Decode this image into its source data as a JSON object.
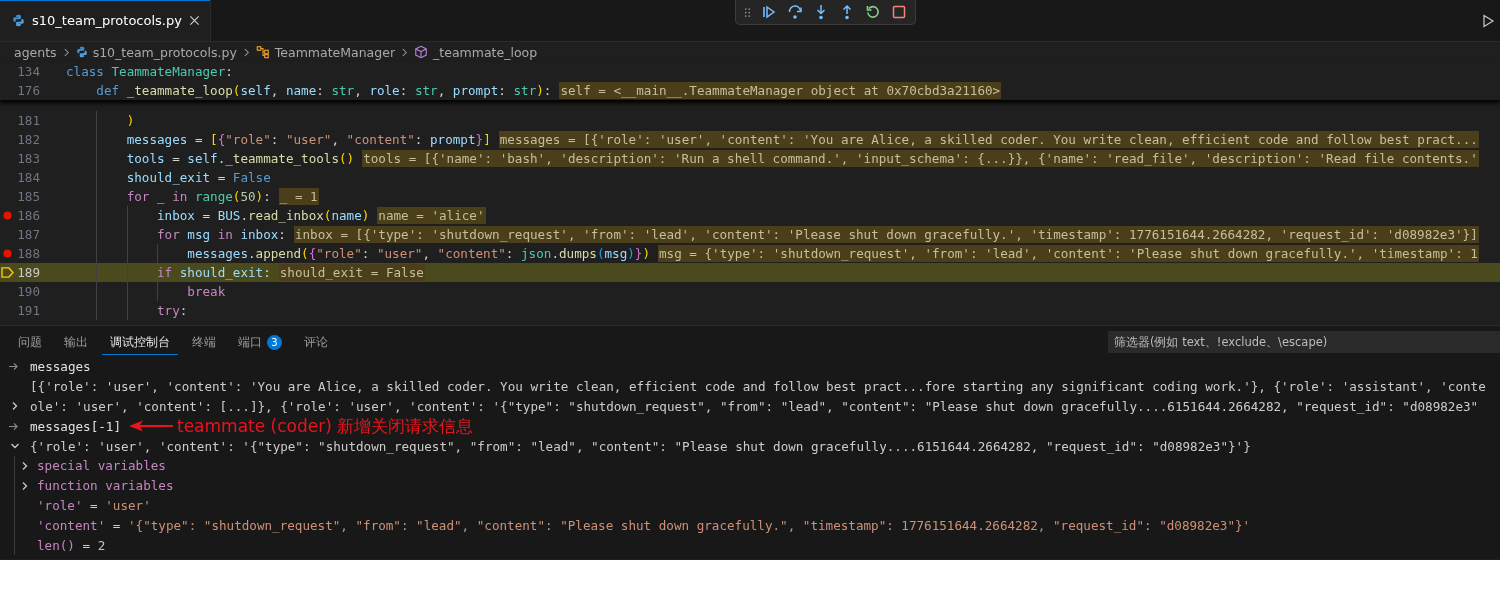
{
  "editor_tab": {
    "title": "s10_team_protocols.py",
    "selected": true
  },
  "breadcrumb": [
    {
      "kind": "folder",
      "label": "agents"
    },
    {
      "kind": "file",
      "label": "s10_team_protocols.py"
    },
    {
      "kind": "class",
      "label": "TeammateManager"
    },
    {
      "kind": "method",
      "label": "_teammate_loop"
    }
  ],
  "sticky_lines": [
    {
      "number": "134",
      "code": [
        {
          "kind": "keyword",
          "text": "class "
        },
        {
          "kind": "class",
          "text": "TeammateManager"
        },
        {
          "kind": "plain",
          "text": ":"
        }
      ]
    },
    {
      "number": "176",
      "code": [
        {
          "kind": "keyword",
          "text": "    def "
        },
        {
          "kind": "function",
          "text": "_teammate_loop"
        },
        {
          "kind": "bracket1",
          "text": "("
        },
        {
          "kind": "variable",
          "text": "self"
        },
        {
          "kind": "plain",
          "text": ", "
        },
        {
          "kind": "variable",
          "text": "name"
        },
        {
          "kind": "plain",
          "text": ": "
        },
        {
          "kind": "class",
          "text": "str"
        },
        {
          "kind": "plain",
          "text": ", "
        },
        {
          "kind": "variable",
          "text": "role"
        },
        {
          "kind": "plain",
          "text": ": "
        },
        {
          "kind": "class",
          "text": "str"
        },
        {
          "kind": "plain",
          "text": ", "
        },
        {
          "kind": "variable",
          "text": "prompt"
        },
        {
          "kind": "plain",
          "text": ": "
        },
        {
          "kind": "class",
          "text": "str"
        },
        {
          "kind": "bracket1",
          "text": ")"
        },
        {
          "kind": "plain",
          "text": ":"
        }
      ],
      "inline_value": "self = <__main__.TeammateManager object at 0x70cbd3a21160>"
    }
  ],
  "code_lines": [
    {
      "number": "181",
      "breakpoint": false,
      "current": false,
      "code": [
        {
          "kind": "bracket1",
          "text": "        )"
        }
      ]
    },
    {
      "number": "182",
      "breakpoint": false,
      "current": false,
      "code": [
        {
          "kind": "variable",
          "text": "        messages"
        },
        {
          "kind": "plain",
          "text": " = "
        },
        {
          "kind": "bracket1",
          "text": "["
        },
        {
          "kind": "bracket2",
          "text": "{"
        },
        {
          "kind": "string",
          "text": "\"role\""
        },
        {
          "kind": "plain",
          "text": ": "
        },
        {
          "kind": "string",
          "text": "\"user\""
        },
        {
          "kind": "plain",
          "text": ", "
        },
        {
          "kind": "string",
          "text": "\"content\""
        },
        {
          "kind": "plain",
          "text": ": "
        },
        {
          "kind": "variable",
          "text": "prompt"
        },
        {
          "kind": "bracket2",
          "text": "}"
        },
        {
          "kind": "bracket1",
          "text": "]"
        }
      ],
      "inline_value": "messages = [{'role': 'user', 'content': 'You are Alice, a skilled coder. You write clean, efficient code and follow best pract..."
    },
    {
      "number": "183",
      "breakpoint": false,
      "current": false,
      "code": [
        {
          "kind": "variable",
          "text": "        tools"
        },
        {
          "kind": "plain",
          "text": " = "
        },
        {
          "kind": "variable",
          "text": "self"
        },
        {
          "kind": "plain",
          "text": "."
        },
        {
          "kind": "function",
          "text": "_teammate_tools"
        },
        {
          "kind": "bracket1",
          "text": "()"
        }
      ],
      "inline_value": "tools = [{'name': 'bash', 'description': 'Run a shell command.', 'input_schema': {...}}, {'name': 'read_file', 'description': 'Read file contents.'"
    },
    {
      "number": "184",
      "breakpoint": false,
      "current": false,
      "code": [
        {
          "kind": "variable",
          "text": "        should_exit"
        },
        {
          "kind": "plain",
          "text": " = "
        },
        {
          "kind": "keyword",
          "text": "False"
        }
      ]
    },
    {
      "number": "185",
      "breakpoint": false,
      "current": false,
      "code": [
        {
          "kind": "control",
          "text": "        for"
        },
        {
          "kind": "variable",
          "text": " _ "
        },
        {
          "kind": "control",
          "text": "in "
        },
        {
          "kind": "class",
          "text": "range"
        },
        {
          "kind": "bracket1",
          "text": "("
        },
        {
          "kind": "number",
          "text": "50"
        },
        {
          "kind": "bracket1",
          "text": ")"
        },
        {
          "kind": "plain",
          "text": ":"
        }
      ],
      "inline_value": "_ = 1"
    },
    {
      "number": "186",
      "breakpoint": true,
      "current": false,
      "code": [
        {
          "kind": "variable",
          "text": "            inbox"
        },
        {
          "kind": "plain",
          "text": " = "
        },
        {
          "kind": "variable",
          "text": "BUS"
        },
        {
          "kind": "plain",
          "text": "."
        },
        {
          "kind": "function",
          "text": "read_inbox"
        },
        {
          "kind": "bracket1",
          "text": "("
        },
        {
          "kind": "variable",
          "text": "name"
        },
        {
          "kind": "bracket1",
          "text": ")"
        }
      ],
      "inline_value": "name = 'alice'"
    },
    {
      "number": "187",
      "breakpoint": false,
      "current": false,
      "code": [
        {
          "kind": "control",
          "text": "            for "
        },
        {
          "kind": "variable",
          "text": "msg "
        },
        {
          "kind": "control",
          "text": "in "
        },
        {
          "kind": "variable",
          "text": "inbox"
        },
        {
          "kind": "plain",
          "text": ":"
        }
      ],
      "inline_value": "inbox = [{'type': 'shutdown_request', 'from': 'lead', 'content': 'Please shut down gracefully.', 'timestamp': 1776151644.2664282, 'request_id': 'd08982e3'}]"
    },
    {
      "number": "188",
      "breakpoint": true,
      "current": false,
      "code": [
        {
          "kind": "variable",
          "text": "                messages"
        },
        {
          "kind": "plain",
          "text": "."
        },
        {
          "kind": "function",
          "text": "append"
        },
        {
          "kind": "bracket1",
          "text": "("
        },
        {
          "kind": "bracket2",
          "text": "{"
        },
        {
          "kind": "string",
          "text": "\"role\""
        },
        {
          "kind": "plain",
          "text": ": "
        },
        {
          "kind": "string",
          "text": "\"user\""
        },
        {
          "kind": "plain",
          "text": ", "
        },
        {
          "kind": "string",
          "text": "\"content\""
        },
        {
          "kind": "plain",
          "text": ": "
        },
        {
          "kind": "class",
          "text": "json"
        },
        {
          "kind": "plain",
          "text": "."
        },
        {
          "kind": "function",
          "text": "dumps"
        },
        {
          "kind": "bracket3",
          "text": "("
        },
        {
          "kind": "variable",
          "text": "msg"
        },
        {
          "kind": "bracket3",
          "text": ")"
        },
        {
          "kind": "bracket2",
          "text": "}"
        },
        {
          "kind": "bracket1",
          "text": ")"
        }
      ],
      "inline_value": "msg = {'type': 'shutdown_request', 'from': 'lead', 'content': 'Please shut down gracefully.', 'timestamp': 1"
    },
    {
      "number": "189",
      "breakpoint": false,
      "current": true,
      "code": [
        {
          "kind": "control",
          "text": "            if "
        },
        {
          "kind": "variable",
          "text": "should_exit"
        },
        {
          "kind": "plain",
          "text": ":"
        }
      ],
      "inline_value": "should_exit = False"
    },
    {
      "number": "190",
      "breakpoint": false,
      "current": false,
      "code": [
        {
          "kind": "control",
          "text": "                break"
        }
      ]
    },
    {
      "number": "191",
      "breakpoint": false,
      "current": false,
      "code": [
        {
          "kind": "control",
          "text": "            try"
        },
        {
          "kind": "plain",
          "text": ":"
        }
      ]
    }
  ],
  "panel": {
    "tabs": [
      {
        "label": "问题",
        "selected": false
      },
      {
        "label": "输出",
        "selected": false
      },
      {
        "label": "调试控制台",
        "selected": true
      },
      {
        "label": "终端",
        "selected": false
      },
      {
        "label": "端口",
        "selected": false,
        "badge": "3"
      },
      {
        "label": "评论",
        "selected": false
      }
    ],
    "filter": {
      "placeholder": "筛选器(例如 text、!exclude、\\escape)"
    },
    "console": [
      {
        "kind": "input",
        "text": "messages"
      },
      {
        "kind": "result",
        "expanded": false,
        "lines": [
          "[{'role': 'user', 'content': 'You are Alice, a skilled coder. You write clean, efficient code and follow best pract...fore starting any significant coding work.'}, {'role': 'assistant', 'conte",
          "ole': 'user', 'content': [...]}, {'role': 'user', 'content': '{\"type\": \"shutdown_request\", \"from\": \"lead\", \"content\": \"Please shut down gracefully....6151644.2664282, \"request_id\": \"d08982e3\""
        ]
      },
      {
        "kind": "input",
        "text": "messages[-1]",
        "annotation": "teammate (coder) 新增关闭请求信息"
      },
      {
        "kind": "result",
        "expanded": true,
        "lines": [
          "{'role': 'user', 'content': '{\"type\": \"shutdown_request\", \"from\": \"lead\", \"content\": \"Please shut down gracefully....6151644.2664282, \"request_id\": \"d08982e3\"}'}"
        ],
        "children": [
          {
            "kind": "group",
            "label": "special variables",
            "expanded": false
          },
          {
            "kind": "group",
            "label": "function variables",
            "expanded": false
          },
          {
            "kind": "string_entry",
            "name": "'role'",
            "operator": "=",
            "value": "'user'"
          },
          {
            "kind": "string_entry",
            "name": "'content'",
            "operator": "=",
            "value": "'{\"type\": \"shutdown_request\", \"from\": \"lead\", \"content\": \"Please shut down gracefully.\", \"timestamp\": 1776151644.2664282, \"request_id\": \"d08982e3\"}'"
          },
          {
            "kind": "number_entry",
            "name": "len()",
            "operator": "=",
            "value": "2"
          }
        ]
      }
    ]
  }
}
